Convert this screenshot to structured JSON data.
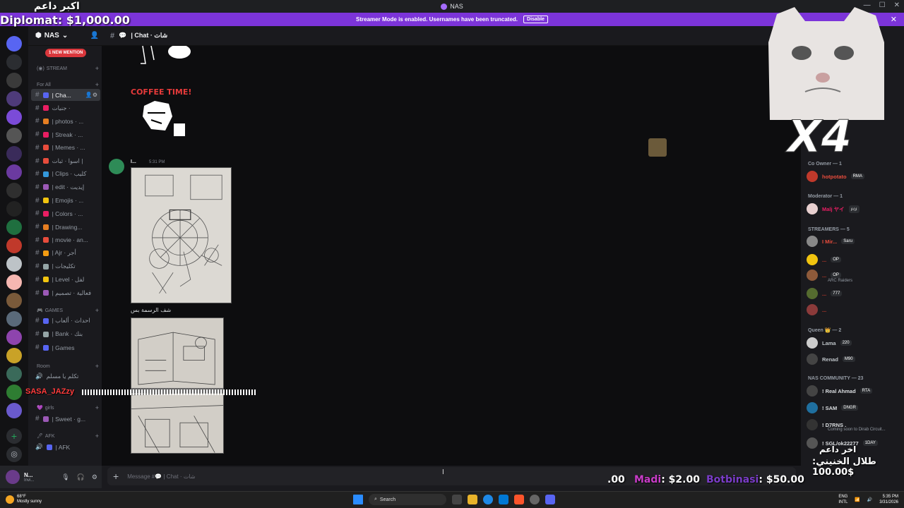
{
  "window": {
    "title": "NAS",
    "controls": [
      "—",
      "☐",
      "✕"
    ]
  },
  "overlays": {
    "top_arabic": "اكبر داعم",
    "diplomat": "Diplomat: $1,000.00",
    "streamer_name": "SASA_JAZzy",
    "bottom_arabic": "اخر داعم",
    "bottom_donation": "طلال الخنيني: 100.00$",
    "donation_amount_left": ".00",
    "donation_madi_name": "Madi",
    "donation_madi_amount": ": $2.00",
    "donation_bot_name": "Botbinasi",
    "donation_bot_amount": ": $50.00"
  },
  "banner": {
    "message": "Streamer Mode is enabled. Usernames have been truncated.",
    "button": "Disable"
  },
  "server": {
    "name": "NAS",
    "mention_badge": "1 NEW MENTION"
  },
  "categories": {
    "stream": "STREAM",
    "for_all": "For All",
    "games": "GAMES",
    "room": "Room",
    "girls": "girls",
    "afk": "AFK"
  },
  "channels": [
    {
      "label": "| Cha...",
      "active": true,
      "color": "#5865f2"
    },
    {
      "label": "جنيات ·",
      "active": false,
      "color": "#e91e63"
    },
    {
      "label": "| photos · ...",
      "active": false,
      "color": "#e67e22"
    },
    {
      "label": "| Streak · ...",
      "active": false,
      "color": "#e91e63"
    },
    {
      "label": "| Memes · ...",
      "active": false,
      "color": "#e74c3c"
    },
    {
      "label": "اسوا · ثبات |",
      "active": false,
      "color": "#e74c3c"
    },
    {
      "label": "| Clips · كليب",
      "active": false,
      "color": "#3498db"
    },
    {
      "label": "| edit · إيديت",
      "active": false,
      "color": "#9b59b6"
    },
    {
      "label": "| Emojis · ...",
      "active": false,
      "color": "#f1c40f"
    },
    {
      "label": "| Colors · ...",
      "active": false,
      "color": "#e91e63"
    },
    {
      "label": "| Drawing...",
      "active": false,
      "color": "#e67e22"
    },
    {
      "label": "| movie · an...",
      "active": false,
      "color": "#e74c3c"
    },
    {
      "label": "| Ajr · أجر",
      "active": false,
      "color": "#f39c12"
    },
    {
      "label": "| تكليجات",
      "active": false,
      "color": "#95a5a6"
    },
    {
      "label": "| Level · لفل",
      "active": false,
      "color": "#f1c40f"
    },
    {
      "label": "| فعالية · تصميم",
      "active": false,
      "color": "#9b59b6"
    }
  ],
  "games_channels": [
    {
      "label": "| احداث · ألعاب",
      "color": "#5865f2"
    },
    {
      "label": "| Bank · بنك",
      "color": "#95a5a6"
    },
    {
      "label": "| Games",
      "color": "#5865f2"
    }
  ],
  "room_channels": [
    {
      "label": "تكلم يا مسلم"
    }
  ],
  "girls_channels": [
    {
      "label": "| Sweet · g...",
      "color": "#9b59b6"
    }
  ],
  "afk_channels": [
    {
      "label": "| AFK",
      "color": "#5865f2"
    }
  ],
  "user": {
    "name": "N...",
    "status": "Invi..."
  },
  "chat": {
    "channel_title": "| Chat · شات",
    "coffee_text": "COFFEE TIME!",
    "author": "I...",
    "time": "5:31 PM",
    "caption": "شف الرسمة بس",
    "composer_placeholder": "Message #💬 | Chat · شات"
  },
  "members": {
    "roles": [
      {
        "name": "Co Owner — 1"
      },
      {
        "name": "Moderator — 1"
      },
      {
        "name": "STREAMERS — 5"
      },
      {
        "name": "Queen 👑 — 2"
      },
      {
        "name": "NAS COMMUNITY — 23"
      }
    ],
    "list": [
      {
        "name": "hotpotato",
        "tag": "RMA",
        "color": "#e74c3c"
      },
      {
        "name": "Malj ヤイ",
        "tag": "ﾒｲﾒ",
        "color": "#e91e63"
      },
      {
        "name": "I Mir...",
        "tag": "Saru",
        "color": "#e74c3c"
      },
      {
        "name": "...",
        "tag": "OP",
        "color": "#c0392b"
      },
      {
        "name": "...",
        "tag": "OP",
        "color": "#c0392b"
      },
      {
        "name": "...",
        "tag": "777",
        "color": "#c0392b"
      },
      {
        "name": "...",
        "tag": "",
        "color": "#c0392b"
      },
      {
        "name": "Lama",
        "tag": "220",
        "color": "#bdc3c7"
      },
      {
        "name": "Renad",
        "tag": "M90",
        "color": "#bdc3c7"
      },
      {
        "name": "! Real Ahmad",
        "tag": "RTA",
        "color": "#dbdee1"
      },
      {
        "name": "! SAM",
        "tag": "DNGR",
        "color": "#dbdee1"
      },
      {
        "name": "! D7RNS .",
        "tag": "",
        "color": "#dbdee1"
      },
      {
        "name": "! SGL/ok22277",
        "tag": "1DAY",
        "color": "#dbdee1"
      }
    ],
    "subtexts": {
      "arc": "ARC Raiders",
      "coming": "Coming soon to Dirab Circuit..."
    }
  },
  "taskbar": {
    "weather_temp": "68°F",
    "weather_desc": "Mostly sunny",
    "search": "Search",
    "lang": "ENG",
    "lang2": "INTL",
    "time": "5:35 PM",
    "date": "3/31/2026"
  }
}
